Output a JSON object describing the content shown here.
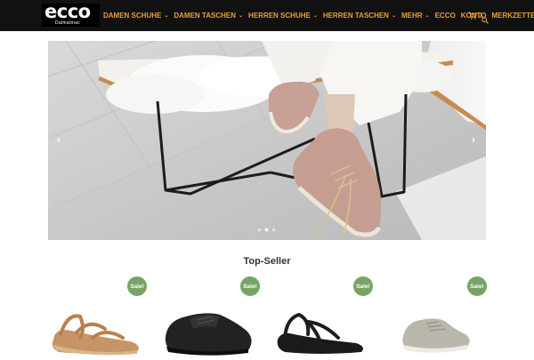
{
  "header": {
    "logo_text": "ecco",
    "logo_subtext": "Dalmatinac",
    "nav": [
      {
        "label": "DAMEN SCHUHE",
        "dropdown": true
      },
      {
        "label": "DAMEN TASCHEN",
        "dropdown": true
      },
      {
        "label": "HERREN SCHUHE",
        "dropdown": true
      },
      {
        "label": "HERREN TASCHEN",
        "dropdown": true
      },
      {
        "label": "MEHR",
        "dropdown": true
      },
      {
        "label": "ECCO",
        "dropdown": false
      },
      {
        "label": "KONTO",
        "dropdown": false
      },
      {
        "label": "MERKZETTEL",
        "dropdown": false
      }
    ],
    "cart_count": "0",
    "icons": {
      "cart": "cart-icon",
      "search": "search-icon",
      "dropdown": "chevron-down-icon"
    }
  },
  "hero": {
    "prev_arrow": "‹",
    "next_arrow": "›",
    "slide_count": 3,
    "active_slide": 2
  },
  "top_seller": {
    "title": "Top-Seller",
    "badge_label": "Sale!",
    "products": [
      {
        "image": "tan-strappy-sandal"
      },
      {
        "image": "black-leather-derby-shoe"
      },
      {
        "image": "black-thong-sandal"
      },
      {
        "image": "grey-low-sneaker"
      }
    ]
  },
  "colors": {
    "header_bg": "#111111",
    "nav_text": "#e8a038",
    "badge": "#77a464"
  }
}
